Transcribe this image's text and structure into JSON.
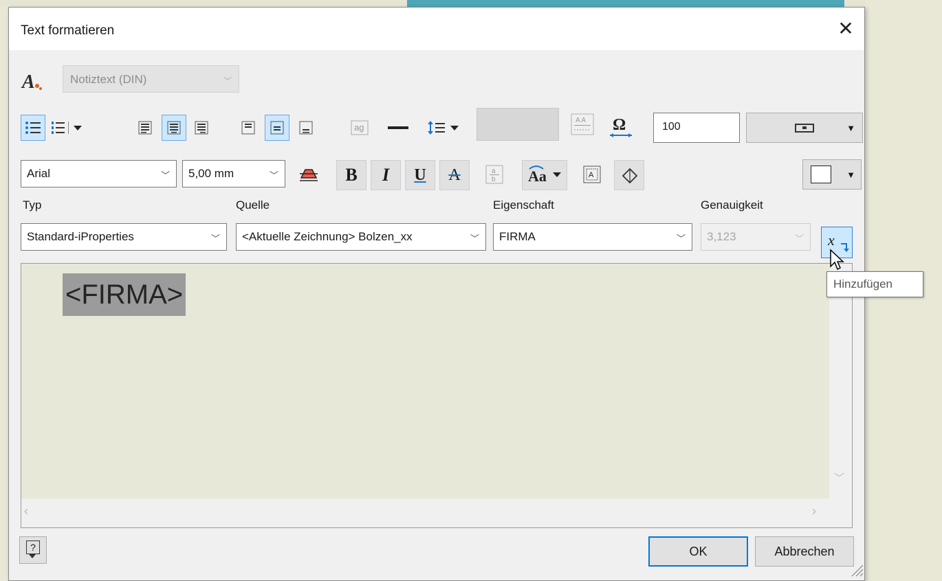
{
  "dialog": {
    "title": "Text formatieren",
    "close_glyph": "✕"
  },
  "style": {
    "icon": "text-style-icon",
    "value": "Notiztext (DIN)"
  },
  "toolbar1": {
    "icons": [
      "bullet-list-icon",
      "numbered-list-icon",
      "align-left-icon",
      "align-center-icon",
      "align-right-icon",
      "valign-top-icon",
      "valign-middle-icon",
      "valign-bottom-icon",
      "text-mask-icon",
      "line-icon",
      "line-spacing-icon",
      "color-field",
      "stack-icon",
      "width-factor-icon"
    ],
    "width_factor": "100"
  },
  "toolbar2": {
    "font": "Arial",
    "size": "5,00 mm",
    "bold": "B",
    "italic": "I",
    "underline": "U",
    "strike": "A"
  },
  "labels": {
    "typ": "Typ",
    "quelle": "Quelle",
    "eigenschaft": "Eigenschaft",
    "genauigkeit": "Genauigkeit"
  },
  "params": {
    "typ": "Standard-iProperties",
    "quelle": "<Aktuelle Zeichnung> Bolzen_xx",
    "eigenschaft": "FIRMA",
    "genauigkeit": "3,123"
  },
  "tooltip": "Hinzufügen",
  "editor": {
    "text": "<FIRMA>"
  },
  "buttons": {
    "ok": "OK",
    "cancel": "Abbrechen",
    "help": "?"
  },
  "colors": {
    "accent": "#0078d7",
    "selected_bg": "#cce8ff",
    "editor_bg": "#e8e8d8",
    "highlight": "#9b9b9b"
  }
}
